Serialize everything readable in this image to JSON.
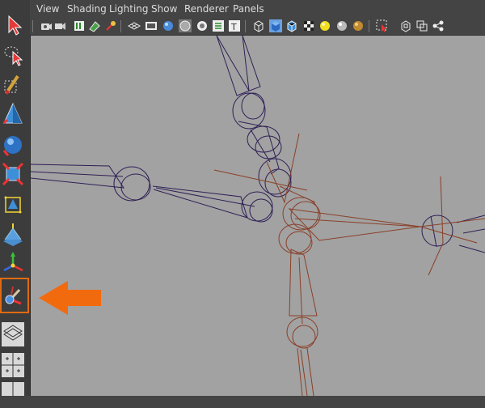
{
  "menubar": {
    "items": [
      {
        "id": "view",
        "label": "View"
      },
      {
        "id": "shading",
        "label": "Shading"
      },
      {
        "id": "lighting",
        "label": "Lighting"
      },
      {
        "id": "show",
        "label": "Show"
      },
      {
        "id": "renderer",
        "label": "Renderer"
      },
      {
        "id": "panels",
        "label": "Panels"
      }
    ]
  },
  "panel_toolbar": {
    "icons": [
      "camera-select-icon",
      "camera-attributes-icon",
      "bookmark-icon",
      "image-plane-icon",
      "2d-pan-zoom-icon",
      "grease-pencil-icon",
      "grid-icon",
      "film-gate-icon",
      "resolution-gate-icon",
      "gate-mask-icon",
      "field-chart-icon",
      "safe-action-icon",
      "safe-title-icon",
      "wireframe-icon",
      "smooth-shade-icon",
      "wireframe-on-shaded-icon",
      "textured-icon",
      "use-all-lights-icon",
      "shadows-icon",
      "ambient-occlusion-icon",
      "isolate-select-icon",
      "xray-icon",
      "xray-joints-icon",
      "backface-culling-icon"
    ]
  },
  "toolbox": {
    "tools": [
      "select-tool-icon",
      "lasso-tool-icon",
      "paint-select-tool-icon",
      "move-tool-icon",
      "rotate-tool-icon",
      "scale-tool-icon",
      "universal-manipulator-icon",
      "soft-modification-icon",
      "show-manipulator-icon",
      "joint-tool-icon",
      "single-perspective-layout-icon",
      "four-view-layout-icon"
    ],
    "highlighted_tool": "joint-tool-icon"
  },
  "colors": {
    "viewport_background": "#a2a2a2",
    "selected_skeleton": "#2f1f55",
    "unselected_skeleton": "#8a4028",
    "callout_arrow": "#f26a0e"
  }
}
